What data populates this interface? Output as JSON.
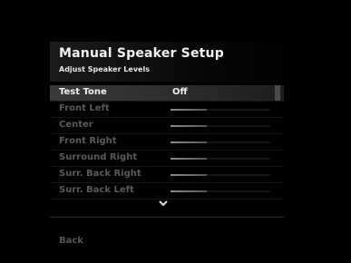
{
  "header": {
    "title": "Manual Speaker Setup",
    "subtitle": "Adjust Speaker Levels"
  },
  "rows": [
    {
      "label": "Test Tone",
      "value": "Off"
    },
    {
      "label": "Front Left"
    },
    {
      "label": "Center"
    },
    {
      "label": "Front Right"
    },
    {
      "label": "Surround Right"
    },
    {
      "label": "Surr. Back Right"
    },
    {
      "label": "Surr. Back Left"
    }
  ],
  "footer": {
    "scroll_indicator_icon": "chevron-down-icon",
    "back_label": "Back"
  }
}
